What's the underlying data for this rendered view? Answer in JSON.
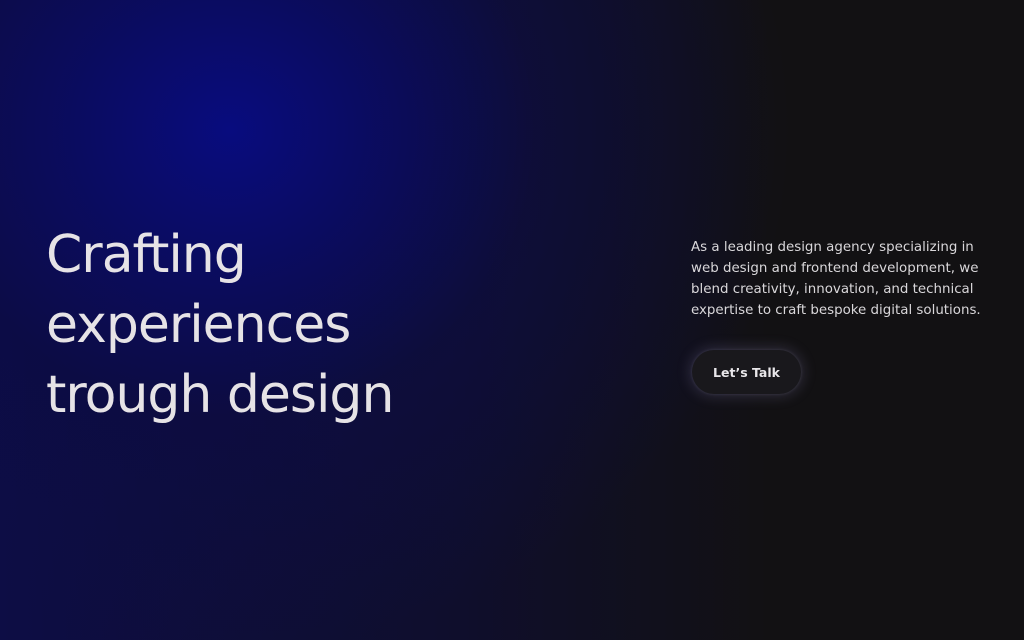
{
  "hero": {
    "heading_lines": [
      "Crafting",
      "experiences",
      "trough design"
    ]
  },
  "intro": {
    "text": "As a leading design agency specializing in web design and frontend development, we blend creativity, innovation, and technical expertise to craft bespoke digital solutions."
  },
  "cta": {
    "label": "Let’s Talk"
  },
  "colors": {
    "background": "#121113",
    "glow": "#0b0f8a",
    "text": "#e6e3e6",
    "button_bg": "#19181c"
  }
}
